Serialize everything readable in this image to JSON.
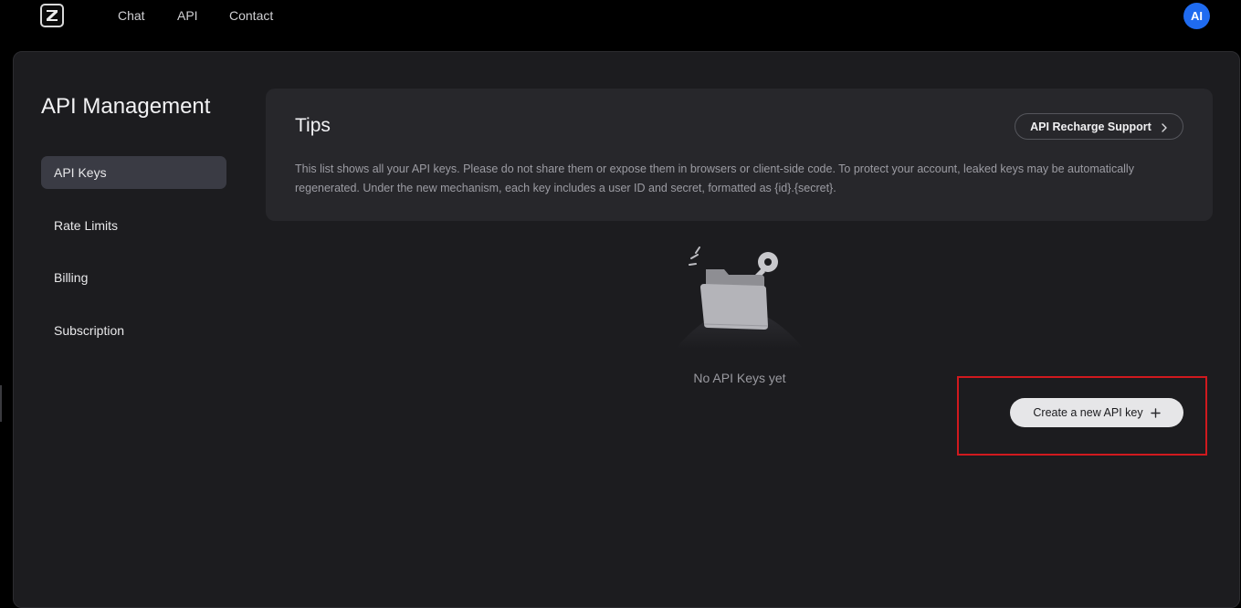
{
  "nav": {
    "links": [
      "Chat",
      "API",
      "Contact"
    ],
    "avatar_initials": "AI",
    "logo_icon": "z-logo-icon"
  },
  "sidebar": {
    "title": "API Management",
    "items": [
      {
        "label": "API Keys",
        "active": true
      },
      {
        "label": "Rate Limits",
        "active": false
      },
      {
        "label": "Billing",
        "active": false
      },
      {
        "label": "Subscription",
        "active": false
      }
    ]
  },
  "tips": {
    "title": "Tips",
    "recharge_label": "API Recharge Support",
    "recharge_icon": "chevron-right-icon",
    "text": "This list shows all your API keys. Please do not share them or expose them in browsers or client-side code. To protect your account, leaked keys may be automatically regenerated. Under the new mechanism, each key includes a user ID and secret, formatted as {id}.{secret}."
  },
  "empty_state": {
    "illustration_icon": "folder-key-icon",
    "text": "No API Keys yet"
  },
  "actions": {
    "create_label": "Create a new API key",
    "create_icon": "plus-icon"
  },
  "colors": {
    "avatar": "#1f6bf0",
    "highlight": "#d0191e",
    "active_nav": "#3a3b44"
  }
}
